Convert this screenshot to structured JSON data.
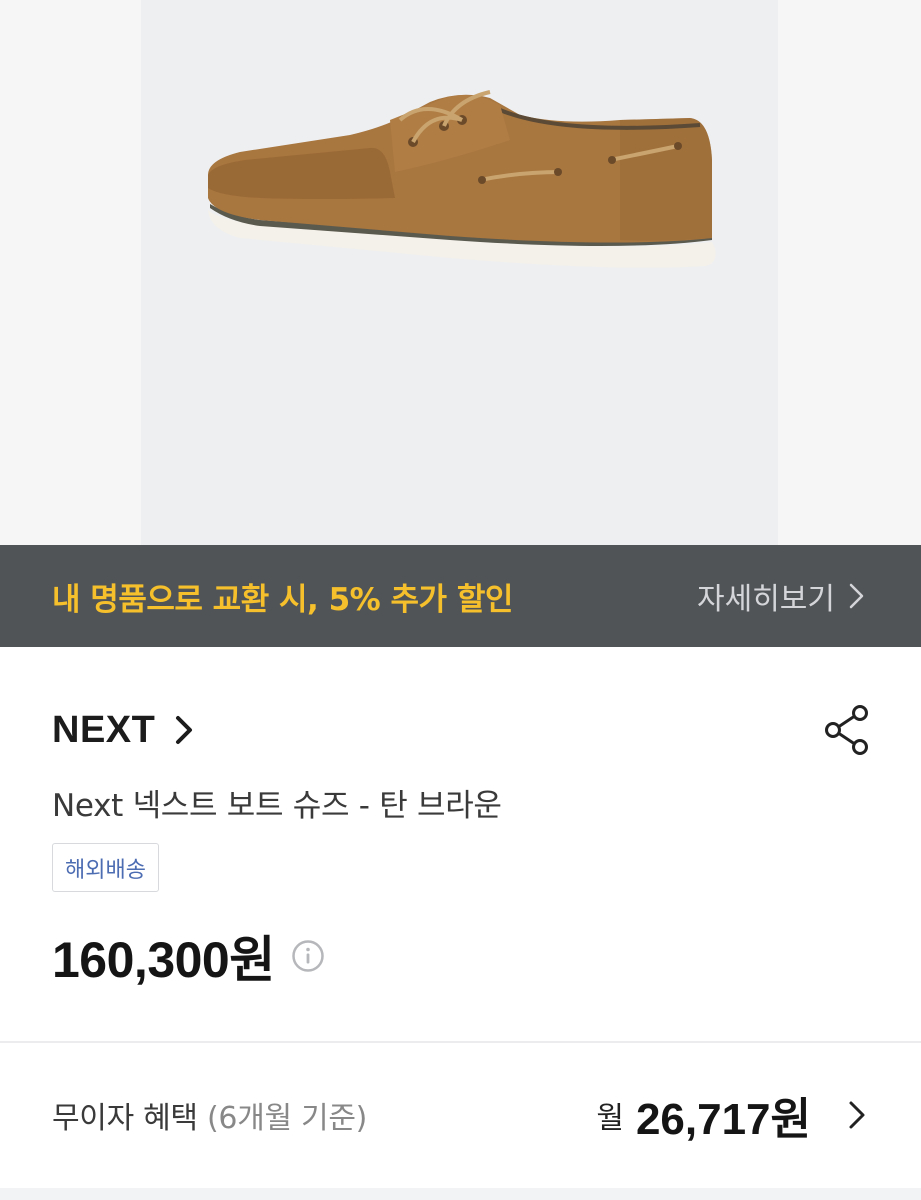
{
  "hero": {
    "image": "boat-shoe-product-image"
  },
  "promo": {
    "text": "내 명품으로 교환 시, 5% 추가 할인",
    "more_label": "자세히보기",
    "text_color": "#f5c02b",
    "background": "#515457"
  },
  "product": {
    "brand": "NEXT",
    "name": "Next 넥스트 보트 슈즈 - 탄 브라운",
    "tag": "해외배송",
    "price": "160,300원"
  },
  "benefit": {
    "label": "무이자 혜택",
    "label_note": "(6개월 기준)",
    "month_prefix": "월",
    "monthly_price": "26,717원"
  },
  "icons": {
    "share": "share-icon",
    "info": "info-icon",
    "chevron": "chevron-right-icon"
  }
}
